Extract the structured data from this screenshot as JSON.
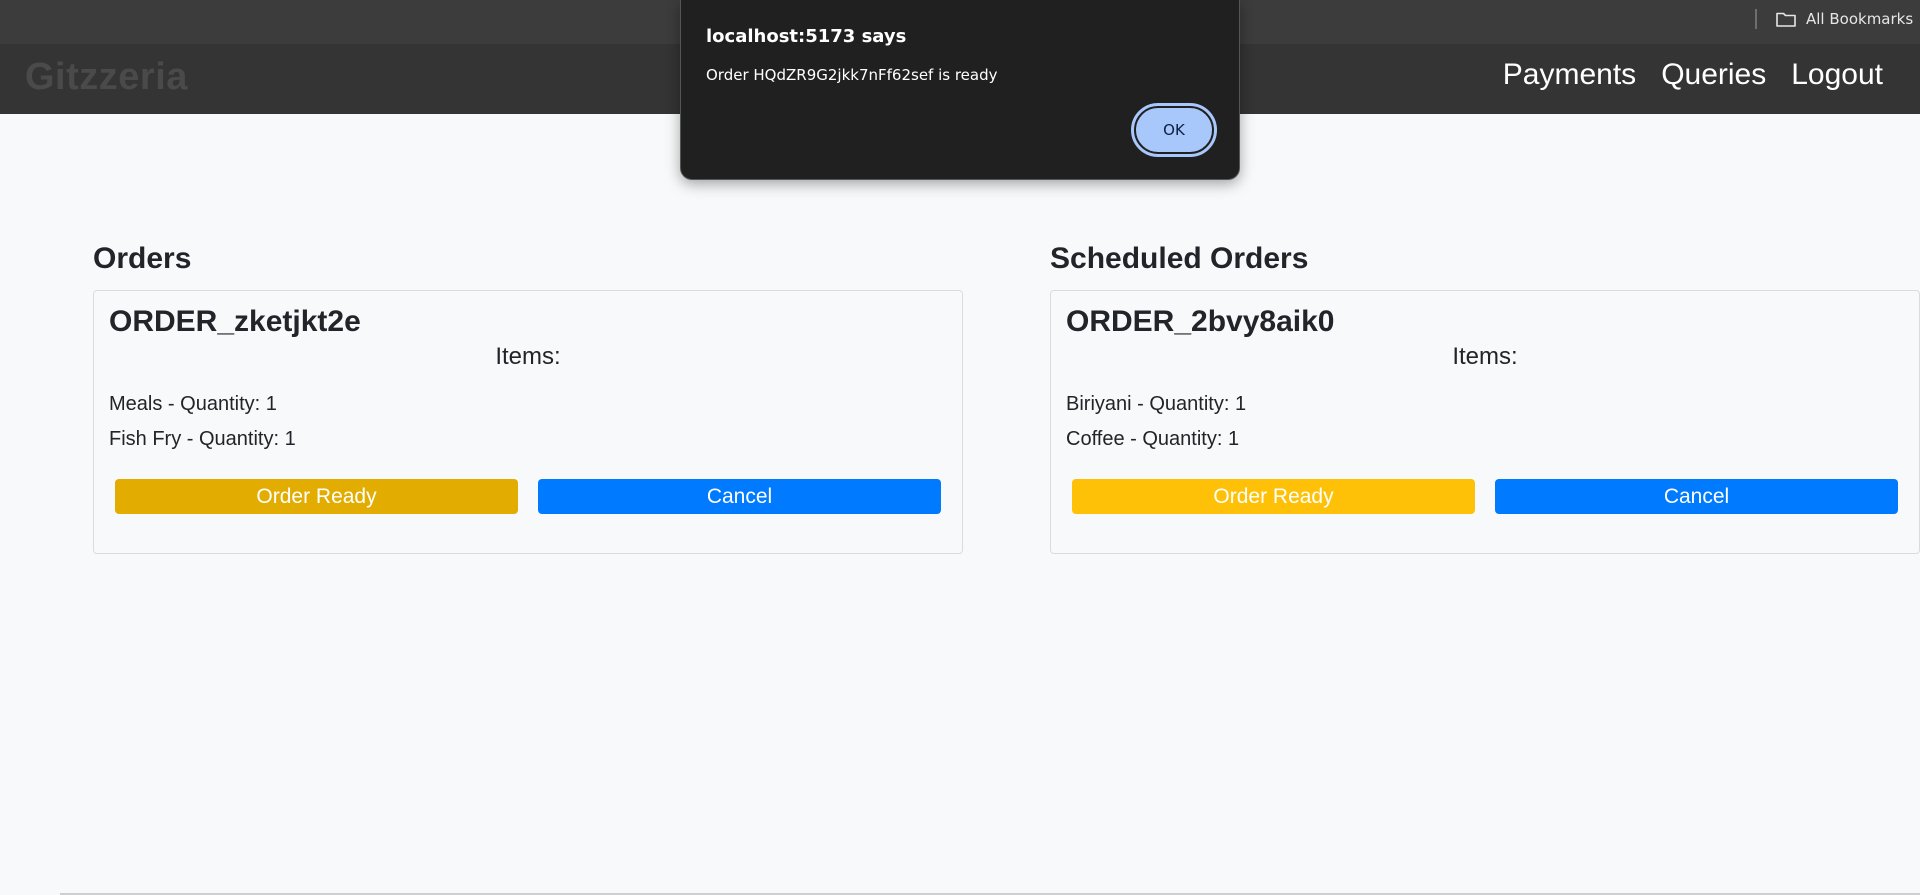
{
  "browser": {
    "bookmarks_label": "All Bookmarks",
    "bookmarks_icon": "folder-icon"
  },
  "app": {
    "brand": "Gitzzeria",
    "nav": [
      {
        "label": "Payments"
      },
      {
        "label": "Queries"
      },
      {
        "label": "Logout"
      }
    ]
  },
  "orders": {
    "title": "Orders",
    "cards": [
      {
        "id": "ORDER_zketjkt2e",
        "items_heading": "Items:",
        "items": [
          {
            "name": "Meals",
            "quantity_text": "Quantity: 1"
          },
          {
            "name": "Fish Fry",
            "quantity_text": "Quantity: 1"
          }
        ],
        "ready_label": "Order Ready",
        "cancel_label": "Cancel"
      }
    ]
  },
  "scheduled_orders": {
    "title": "Scheduled Orders",
    "cards": [
      {
        "id": "ORDER_2bvy8aik0",
        "items_heading": "Items:",
        "items": [
          {
            "name": "Biriyani",
            "quantity_text": "Quantity: 1"
          },
          {
            "name": "Coffee",
            "quantity_text": "Quantity: 1"
          }
        ],
        "ready_label": "Order Ready",
        "cancel_label": "Cancel"
      }
    ]
  },
  "dialog": {
    "title": "localhost:5173 says",
    "message": "Order HQdZR9G2jkk7nFf62sef is ready",
    "ok_label": "OK"
  },
  "colors": {
    "navbar": "#343434",
    "ready_hover": "#e3ac00",
    "ready": "#ffc107",
    "cancel": "#007bff",
    "dialog_bg": "#202020",
    "dialog_button": "#a8c7fa"
  }
}
